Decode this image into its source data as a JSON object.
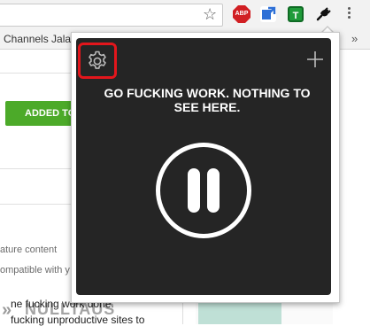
{
  "bookmarks": {
    "text": "Channels Jalan"
  },
  "extensions": {
    "abp_label": "ABP",
    "green_label": "T"
  },
  "page": {
    "add_button_label": "ADDED TO",
    "feature_line_1": "ature content",
    "feature_line_2": "ompatible with y",
    "caption_line_1": "ne fucking work done.",
    "caption_line_2": "fucking unproductive sites to",
    "logo_text": "NULLTAUS"
  },
  "popup": {
    "message": "GO FUCKING WORK. NOTHING TO SEE HERE."
  },
  "colors": {
    "popup_background": "#252525",
    "highlight_border": "#e3161c",
    "add_button": "#4caa29"
  },
  "icons": {
    "settings": "gear-icon",
    "add": "plus-icon",
    "pause": "pause-icon",
    "bookmark_star": "star-icon",
    "menu": "kebab-menu-icon"
  }
}
